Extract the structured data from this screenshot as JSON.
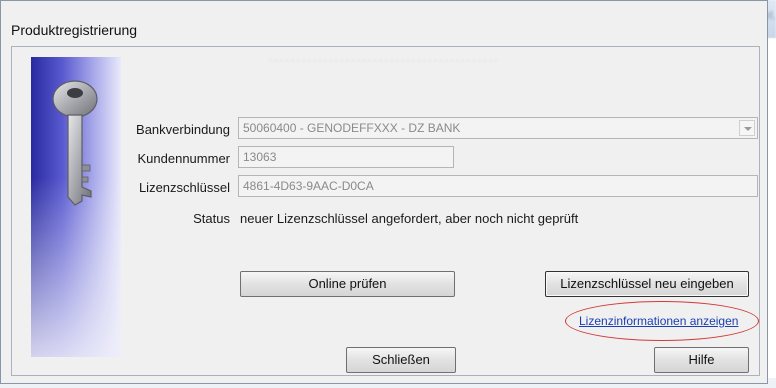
{
  "window": {
    "title": "Produktregistrierung"
  },
  "form": {
    "bank_label": "Bankverbindung",
    "bank_value": "50060400 - GENODEFFXXX - DZ BANK",
    "customer_label": "Kundennummer",
    "customer_value": "13063",
    "license_label": "Lizenzschlüssel",
    "license_value": "4861-4D63-9AAC-D0CA",
    "status_label": "Status",
    "status_value": "neuer Lizenzschlüssel angefordert, aber noch nicht geprüft"
  },
  "buttons": {
    "check_online": "Online prüfen",
    "enter_new_key": "Lizenzschlüssel neu eingeben",
    "close": "Schließen",
    "help": "Hilfe"
  },
  "links": {
    "show_license_info": "Lizenzinformationen anzeigen"
  },
  "colors": {
    "annotation_ellipse": "#d23a3a",
    "link": "#1a3fb3",
    "side_panel": "#2a2aa0"
  },
  "icons": {
    "side_image": "key-icon",
    "dropdown": "chevron-down-icon"
  }
}
